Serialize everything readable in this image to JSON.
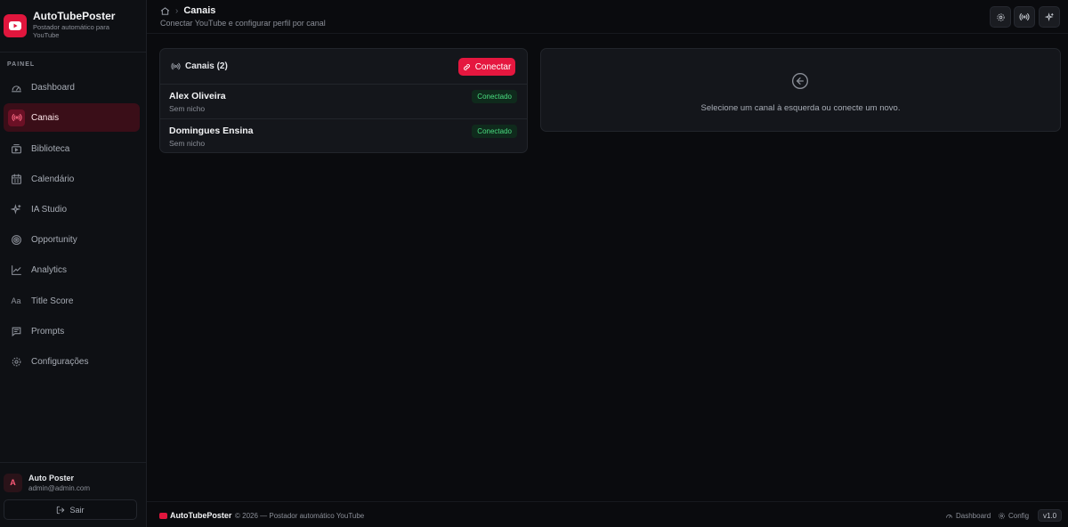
{
  "brand": {
    "title": "AutoTubePoster",
    "subtitle": "Postador automático para YouTube",
    "accent": "#e0163d",
    "logo_icon": "youtube-icon"
  },
  "sidebar": {
    "section_label": "PAINEL",
    "items": [
      {
        "label": "Dashboard",
        "icon": "gauge-icon",
        "active": false
      },
      {
        "label": "Canais",
        "icon": "broadcast-icon",
        "active": true
      },
      {
        "label": "Biblioteca",
        "icon": "video-library-icon",
        "active": false
      },
      {
        "label": "Calendário",
        "icon": "calendar-icon",
        "active": false
      },
      {
        "label": "IA Studio",
        "icon": "sparkles-icon",
        "active": false
      },
      {
        "label": "Opportunity",
        "icon": "target-icon",
        "active": false
      },
      {
        "label": "Analytics",
        "icon": "line-chart-icon",
        "active": false
      },
      {
        "label": "Title Score",
        "icon": "text-aa-icon",
        "active": false
      },
      {
        "label": "Prompts",
        "icon": "message-icon",
        "active": false
      },
      {
        "label": "Configurações",
        "icon": "gear-icon",
        "active": false
      }
    ],
    "user": {
      "initial": "A",
      "name": "Auto Poster",
      "email": "admin@admin.com"
    },
    "logout_label": "Sair"
  },
  "header": {
    "breadcrumb_current": "Canais",
    "subtitle": "Conectar YouTube e configurar perfil por canal",
    "actions": [
      "gear-icon",
      "broadcast-icon",
      "sparkles-icon"
    ]
  },
  "channels_panel": {
    "title": "Canais (2)",
    "connect_label": "Conectar",
    "channels": [
      {
        "name": "Alex Oliveira",
        "niche": "Sem nicho",
        "status": "Conectado"
      },
      {
        "name": "Domingues Ensina",
        "niche": "Sem nicho",
        "status": "Conectado"
      }
    ],
    "status_color": "#4ade80"
  },
  "detail_panel": {
    "message": "Selecione um canal à esquerda ou conecte um novo."
  },
  "footer": {
    "brand": "AutoTubePoster",
    "copyright": "© 2026 — Postador automático YouTube",
    "links": [
      "Dashboard",
      "Config"
    ],
    "version": "v1.0"
  }
}
